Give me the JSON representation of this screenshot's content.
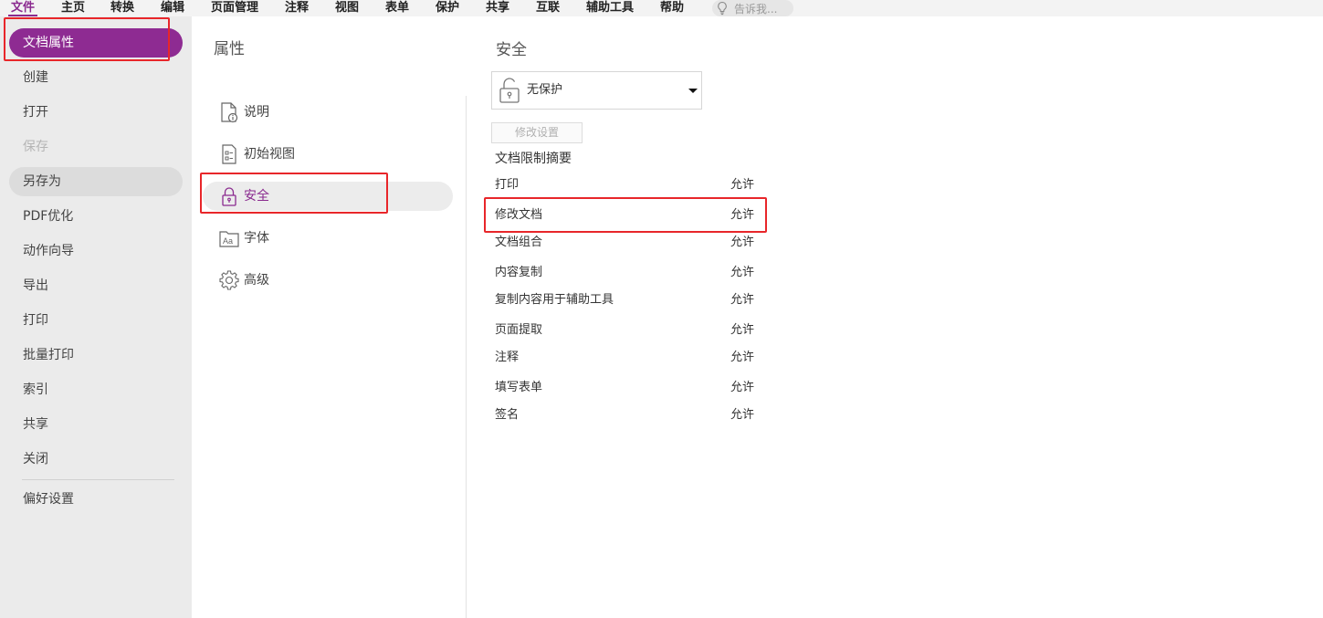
{
  "menu": {
    "items": [
      "文件",
      "主页",
      "转换",
      "编辑",
      "页面管理",
      "注释",
      "视图",
      "表单",
      "保护",
      "共享",
      "互联",
      "辅助工具",
      "帮助"
    ],
    "active_index": 0,
    "tell_me_placeholder": "告诉我..."
  },
  "sidebar": {
    "items": [
      {
        "label": "文档属性",
        "state": "selected"
      },
      {
        "label": "创建",
        "state": "normal"
      },
      {
        "label": "打开",
        "state": "normal"
      },
      {
        "label": "保存",
        "state": "disabled"
      },
      {
        "label": "另存为",
        "state": "hover"
      },
      {
        "label": "PDF优化",
        "state": "normal"
      },
      {
        "label": "动作向导",
        "state": "normal"
      },
      {
        "label": "导出",
        "state": "normal"
      },
      {
        "label": "打印",
        "state": "normal"
      },
      {
        "label": "批量打印",
        "state": "normal"
      },
      {
        "label": "索引",
        "state": "normal"
      },
      {
        "label": "共享",
        "state": "normal"
      },
      {
        "label": "关闭",
        "state": "normal"
      },
      {
        "label": "偏好设置",
        "state": "normal"
      }
    ]
  },
  "properties": {
    "title": "属性",
    "items": [
      {
        "label": "说明",
        "icon": "document-info-icon"
      },
      {
        "label": "初始视图",
        "icon": "document-checklist-icon"
      },
      {
        "label": "安全",
        "icon": "lock-icon",
        "selected": true
      },
      {
        "label": "字体",
        "icon": "font-icon"
      },
      {
        "label": "高级",
        "icon": "gear-icon"
      }
    ]
  },
  "security": {
    "title": "安全",
    "dropdown_value": "无保护",
    "modify_button": "修改设置",
    "summary_title": "文档限制摘要",
    "permissions": [
      {
        "name": "打印",
        "value": "允许"
      },
      {
        "name": "修改文档",
        "value": "允许"
      },
      {
        "name": "文档组合",
        "value": "允许"
      },
      {
        "name": "内容复制",
        "value": "允许"
      },
      {
        "name": "复制内容用于辅助工具",
        "value": "允许"
      },
      {
        "name": "页面提取",
        "value": "允许"
      },
      {
        "name": "注释",
        "value": "允许"
      },
      {
        "name": "填写表单",
        "value": "允许"
      },
      {
        "name": "签名",
        "value": "允许"
      }
    ]
  },
  "colors": {
    "accent": "#8e2b92",
    "highlight_box": "#e8262a"
  }
}
